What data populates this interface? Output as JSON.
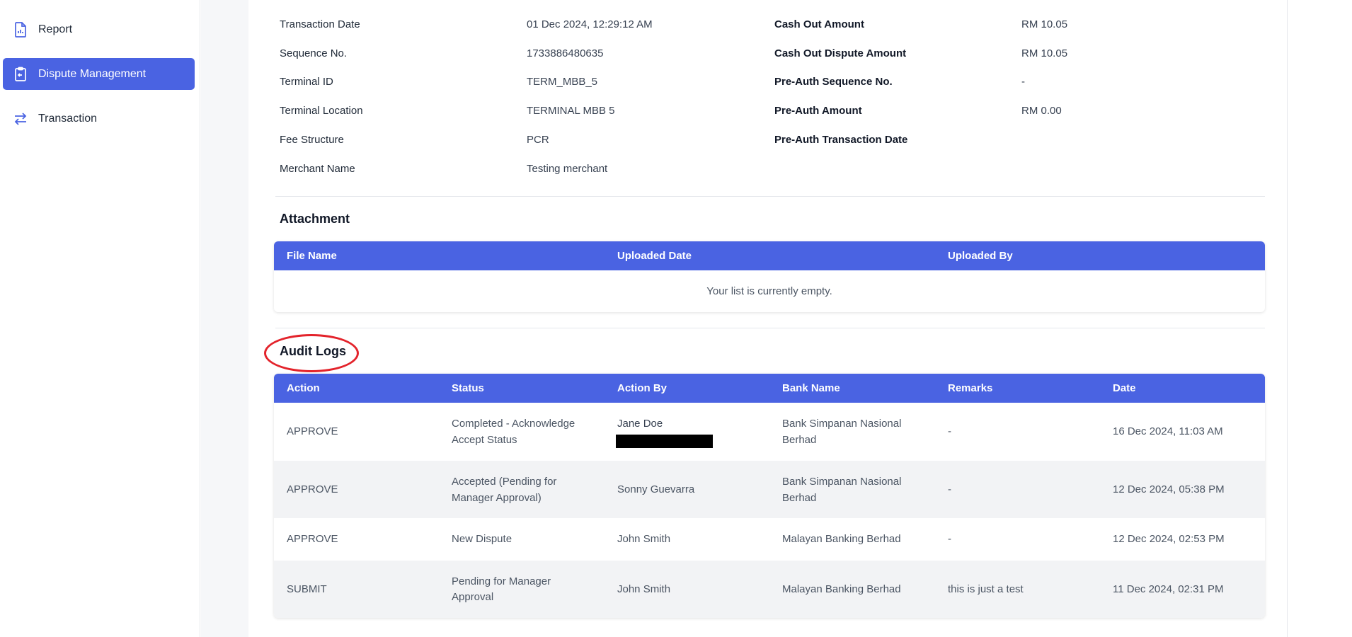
{
  "sidebar": {
    "items": [
      {
        "label": "Report",
        "icon": "report-icon"
      },
      {
        "label": "Dispute Management",
        "icon": "dispute-clipboard-icon",
        "active": true
      },
      {
        "label": "Transaction",
        "icon": "transfer-arrows-icon"
      }
    ]
  },
  "details": {
    "left": [
      {
        "label": "Transaction Date",
        "value": "01 Dec 2024, 12:29:12 AM"
      },
      {
        "label": "Sequence No.",
        "value": "1733886480635"
      },
      {
        "label": "Terminal ID",
        "value": "TERM_MBB_5"
      },
      {
        "label": "Terminal Location",
        "value": "TERMINAL MBB 5"
      },
      {
        "label": "Fee Structure",
        "value": "PCR"
      },
      {
        "label": "Merchant Name",
        "value": "Testing merchant"
      }
    ],
    "right": [
      {
        "label": "Cash Out Amount",
        "value": "RM 10.05"
      },
      {
        "label": "Cash Out Dispute Amount",
        "value": "RM 10.05"
      },
      {
        "label": "Pre-Auth Sequence No.",
        "value": "-"
      },
      {
        "label": "Pre-Auth Amount",
        "value": "RM 0.00"
      },
      {
        "label": "Pre-Auth Transaction Date",
        "value": ""
      }
    ]
  },
  "attachment": {
    "title": "Attachment",
    "columns": [
      "File Name",
      "Uploaded Date",
      "Uploaded By"
    ],
    "empty_text": "Your list is currently empty."
  },
  "audit_logs": {
    "title": "Audit Logs",
    "columns": [
      "Action",
      "Status",
      "Action By",
      "Bank Name",
      "Remarks",
      "Date"
    ],
    "rows": [
      {
        "action": "APPROVE",
        "status": [
          "Completed - Acknowledge",
          "Accept Status"
        ],
        "action_by": "Jane Doe",
        "redacted": true,
        "bank": [
          "Bank Simpanan Nasional",
          "Berhad"
        ],
        "remarks": "-",
        "date": "16 Dec 2024, 11:03 AM"
      },
      {
        "action": "APPROVE",
        "status": [
          "Accepted (Pending for",
          "Manager Approval)"
        ],
        "action_by": "Sonny Guevarra",
        "bank": [
          "Bank Simpanan Nasional",
          "Berhad"
        ],
        "remarks": "-",
        "date": "12 Dec 2024, 05:38 PM"
      },
      {
        "action": "APPROVE",
        "status": [
          "New Dispute"
        ],
        "action_by": "John Smith",
        "bank": [
          "Malayan Banking Berhad"
        ],
        "remarks": "-",
        "date": "12 Dec 2024, 02:53 PM"
      },
      {
        "action": "SUBMIT",
        "status": [
          "Pending for Manager",
          "Approval"
        ],
        "action_by": "John Smith",
        "bank": [
          "Malayan Banking Berhad"
        ],
        "remarks": "this is just a test",
        "date": "11 Dec 2024, 02:31 PM"
      }
    ]
  },
  "colors": {
    "accent": "#4a63e2",
    "highlight": "#e3232b",
    "alt_row": "#f2f3f5"
  }
}
